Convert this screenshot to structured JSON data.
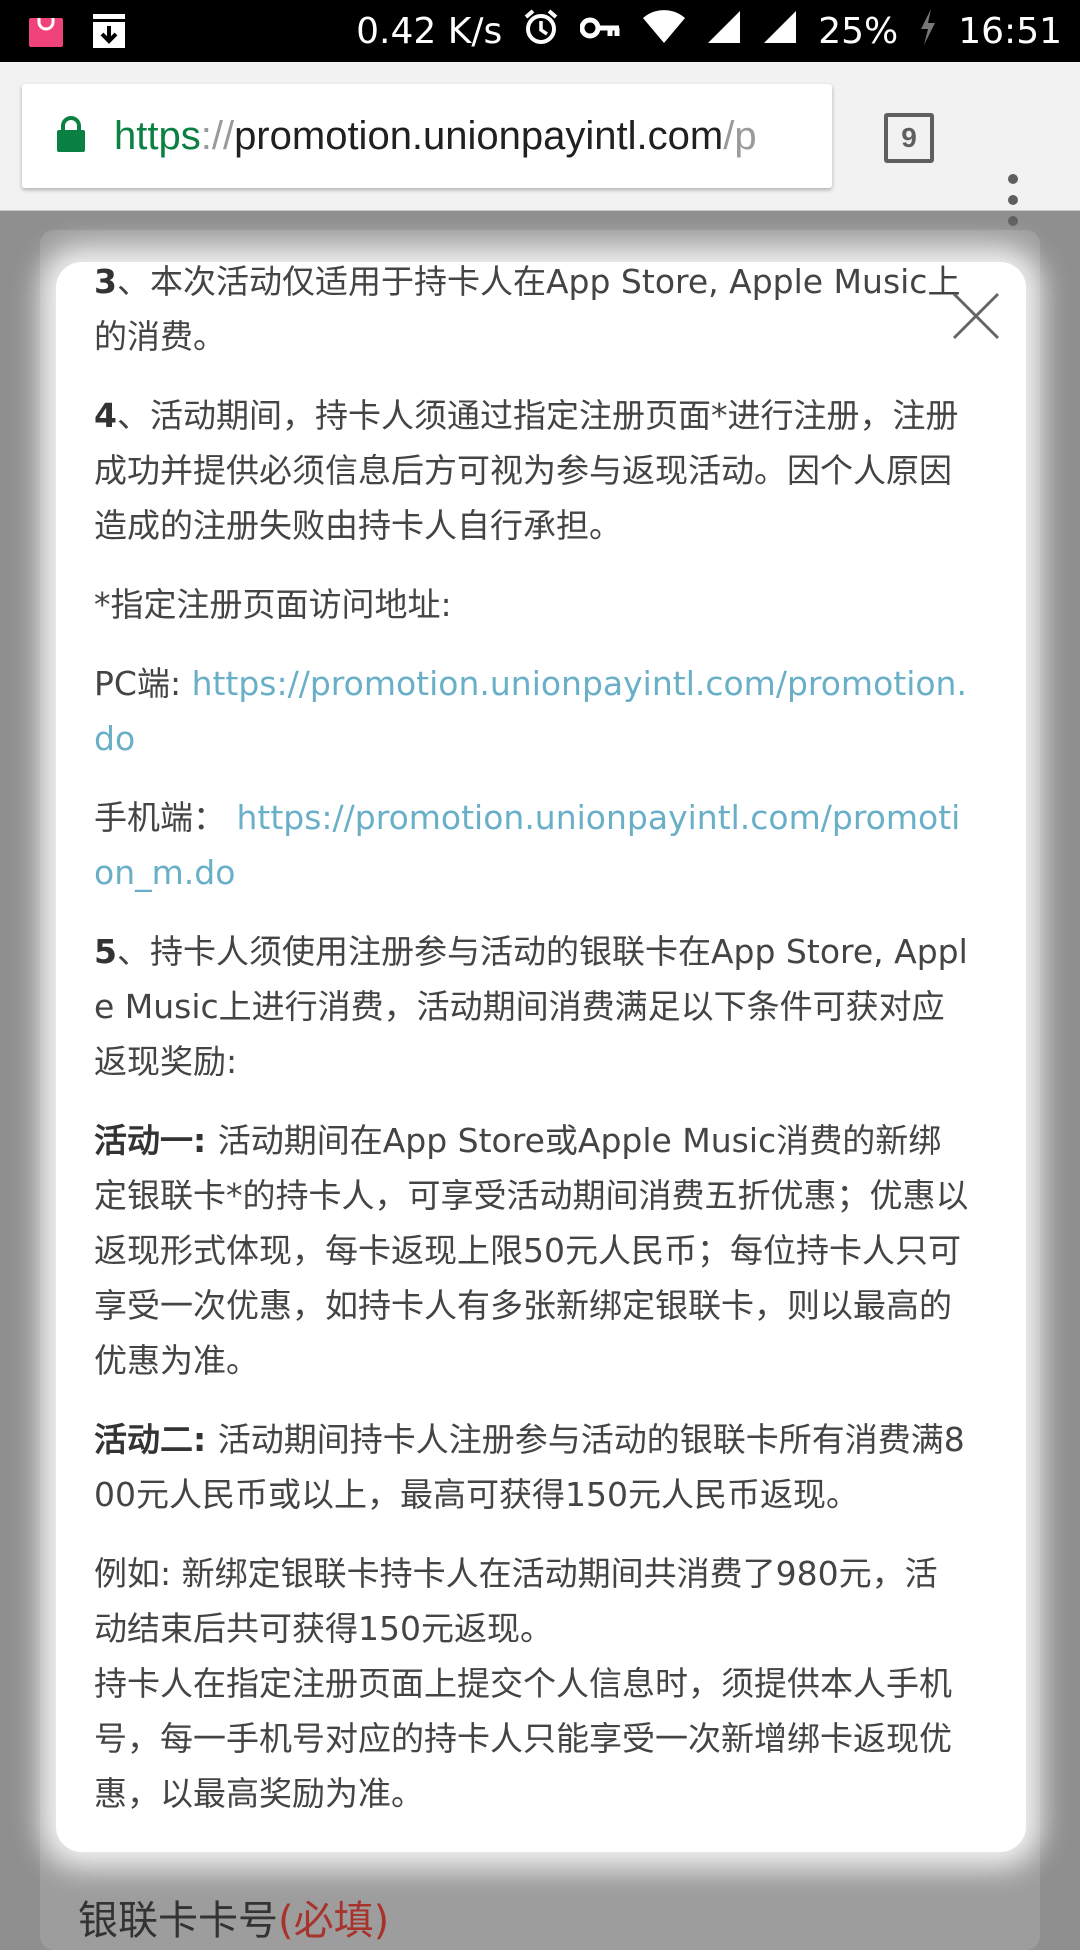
{
  "status_bar": {
    "speed": "0.42 K/s",
    "battery": "25%",
    "time": "16:51",
    "icons": [
      "shopping-bag-icon",
      "download-icon",
      "alarm-icon",
      "vpn-key-icon",
      "wifi-icon",
      "signal-icon",
      "signal-icon",
      "charging-icon"
    ]
  },
  "browser": {
    "url_scheme": "https",
    "url_sep": "://",
    "url_host": "promotion.unionpayintl.com",
    "url_tail": "/p",
    "tab_count": "9",
    "colors": {
      "lock": "#0b8043",
      "scheme": "#0b8043"
    }
  },
  "page_bg": {
    "field_label": "银联卡卡号",
    "required": "(必填)"
  },
  "modal": {
    "item3": {
      "num": "3",
      "text": "、本次活动仅适用于持卡人在App Store, Apple Music上的消费。"
    },
    "item4": {
      "num": "4",
      "text": "、活动期间，持卡人须通过指定注册页面*进行注册，注册成功并提供必须信息后方可视为参与返现活动。因个人原因造成的注册失败由持卡人自行承担。"
    },
    "note": "*指定注册页面访问地址:",
    "pc_label": "PC端: ",
    "pc_link": "https://promotion.unionpayintl.com/promotion.do",
    "mobile_label": "手机端： ",
    "mobile_link": "https://promotion.unionpayintl.com/promotion_m.do",
    "item5": {
      "num": "5",
      "text": "、持卡人须使用注册参与活动的银联卡在App Store, Apple Music上进行消费，活动期间消费满足以下条件可获对应返现奖励:"
    },
    "activity1": {
      "title": "活动一: ",
      "text": "活动期间在App Store或Apple Music消费的新绑定银联卡*的持卡人，可享受活动期间消费五折优惠；优惠以返现形式体现，每卡返现上限50元人民币；每位持卡人只可享受一次优惠，如持卡人有多张新绑定银联卡，则以最高的优惠为准。"
    },
    "activity2": {
      "title": "活动二: ",
      "text": "活动期间持卡人注册参与活动的银联卡所有消费满800元人民币或以上，最高可获得150元人民币返现。"
    },
    "example": "例如: 新绑定银联卡持卡人在活动期间共消费了980元，活动结束后共可获得150元返现。",
    "note2": "持卡人在指定注册页面上提交个人信息时，须提供本人手机号，每一手机号对应的持卡人只能享受一次新增绑卡返现优惠，以最高奖励为准。",
    "link_color": "#6aafc8"
  }
}
